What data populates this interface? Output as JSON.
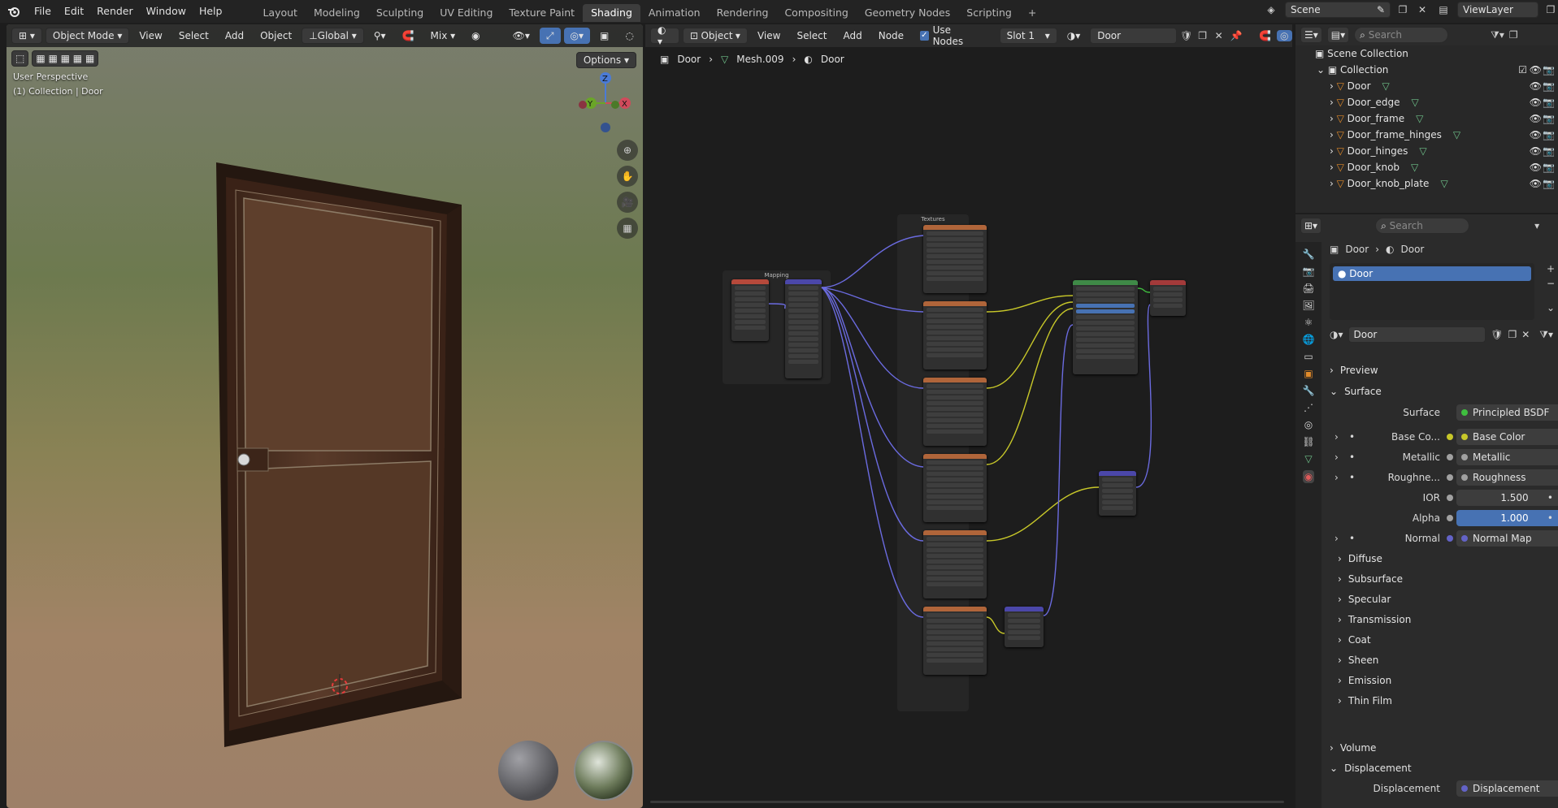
{
  "menus": [
    "File",
    "Edit",
    "Render",
    "Window",
    "Help"
  ],
  "workspaces": [
    "Layout",
    "Modeling",
    "Sculpting",
    "UV Editing",
    "Texture Paint",
    "Shading",
    "Animation",
    "Rendering",
    "Compositing",
    "Geometry Nodes",
    "Scripting"
  ],
  "active_workspace": "Shading",
  "scene": {
    "name": "Scene",
    "view_layer": "ViewLayer"
  },
  "viewport": {
    "mode": "Object Mode",
    "menus": [
      "View",
      "Select",
      "Add",
      "Object"
    ],
    "orientation": "Global",
    "snap_mode": "Mix",
    "options_label": "Options",
    "overlay_line1": "User Perspective",
    "overlay_line2": "(1) Collection | Door",
    "gizmo_axes": [
      "X",
      "Y",
      "Z"
    ]
  },
  "node_editor": {
    "object_type": "Object",
    "menus": [
      "View",
      "Select",
      "Add",
      "Node"
    ],
    "use_nodes_label": "Use Nodes",
    "slot": "Slot 1",
    "material": "Door",
    "breadcrumb": [
      "Door",
      "Mesh.009",
      "Door"
    ],
    "frame_mapping": "Mapping",
    "frame_textures": "Textures"
  },
  "outliner": {
    "search_placeholder": "Search",
    "root": "Scene Collection",
    "collection": "Collection",
    "objects": [
      "Door",
      "Door_edge",
      "Door_frame",
      "Door_frame_hinges",
      "Door_hinges",
      "Door_knob",
      "Door_knob_plate"
    ]
  },
  "properties": {
    "search_placeholder": "Search",
    "breadcrumb": [
      "Door",
      "Door"
    ],
    "material_slot": "Door",
    "material_name": "Door",
    "sections": {
      "preview": "Preview",
      "surface": "Surface",
      "volume": "Volume",
      "displacement": "Displacement"
    },
    "surface_label": "Surface",
    "surface_value": "Principled BSDF",
    "inputs": [
      {
        "label": "Base Co...",
        "value": "Base Color",
        "dot": "#c7c729"
      },
      {
        "label": "Metallic",
        "value": "Metallic",
        "dot": "#a1a1a1"
      },
      {
        "label": "Roughne...",
        "value": "Roughness",
        "dot": "#a1a1a1"
      },
      {
        "label": "IOR",
        "value": "1.500",
        "dot": "#a1a1a1"
      },
      {
        "label": "Alpha",
        "value": "1.000",
        "dot": "#a1a1a1"
      },
      {
        "label": "Normal",
        "value": "Normal Map",
        "dot": "#6363c7"
      }
    ],
    "subsections": [
      "Diffuse",
      "Subsurface",
      "Specular",
      "Transmission",
      "Coat",
      "Sheen",
      "Emission",
      "Thin Film"
    ],
    "displacement_label": "Displacement",
    "displacement_value": "Displacement"
  }
}
